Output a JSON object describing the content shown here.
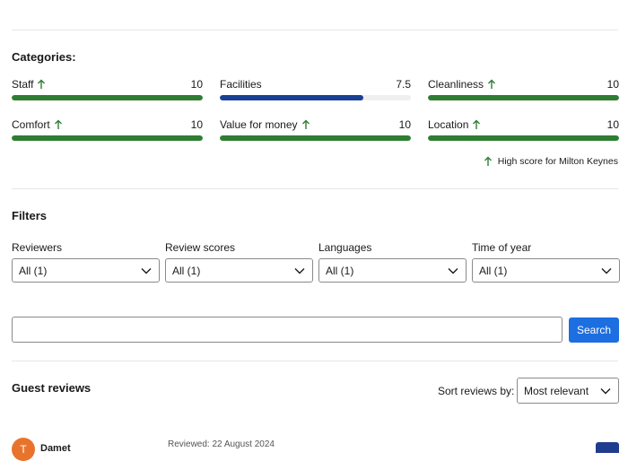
{
  "categories": {
    "title": "Categories:",
    "items": [
      {
        "name": "Staff",
        "score": "10",
        "value": 10,
        "high": true,
        "color": "#2e7d32"
      },
      {
        "name": "Facilities",
        "score": "7.5",
        "value": 7.5,
        "high": false,
        "color": "#1a3f96"
      },
      {
        "name": "Cleanliness",
        "score": "10",
        "value": 10,
        "high": true,
        "color": "#2e7d32"
      },
      {
        "name": "Comfort",
        "score": "10",
        "value": 10,
        "high": true,
        "color": "#2e7d32"
      },
      {
        "name": "Value for money",
        "score": "10",
        "value": 10,
        "high": true,
        "color": "#2e7d32"
      },
      {
        "name": "Location",
        "score": "10",
        "value": 10,
        "high": true,
        "color": "#2e7d32"
      }
    ],
    "max": 10,
    "high_note": "High score for Milton Keynes"
  },
  "filters": {
    "title": "Filters",
    "items": [
      {
        "label": "Reviewers",
        "value": "All (1)"
      },
      {
        "label": "Review scores",
        "value": "All (1)"
      },
      {
        "label": "Languages",
        "value": "All (1)"
      },
      {
        "label": "Time of year",
        "value": "All (1)"
      }
    ]
  },
  "search": {
    "placeholder": "",
    "button_label": "Search"
  },
  "reviews": {
    "title": "Guest reviews",
    "sort_label": "Sort reviews by:",
    "sort_value": "Most relevant",
    "first": {
      "avatar_letter": "T",
      "name": "Damet",
      "reviewed": "Reviewed: 22 August 2024"
    }
  },
  "colors": {
    "high_arrow": "#2e7d32",
    "accent": "#1d6ee0"
  }
}
